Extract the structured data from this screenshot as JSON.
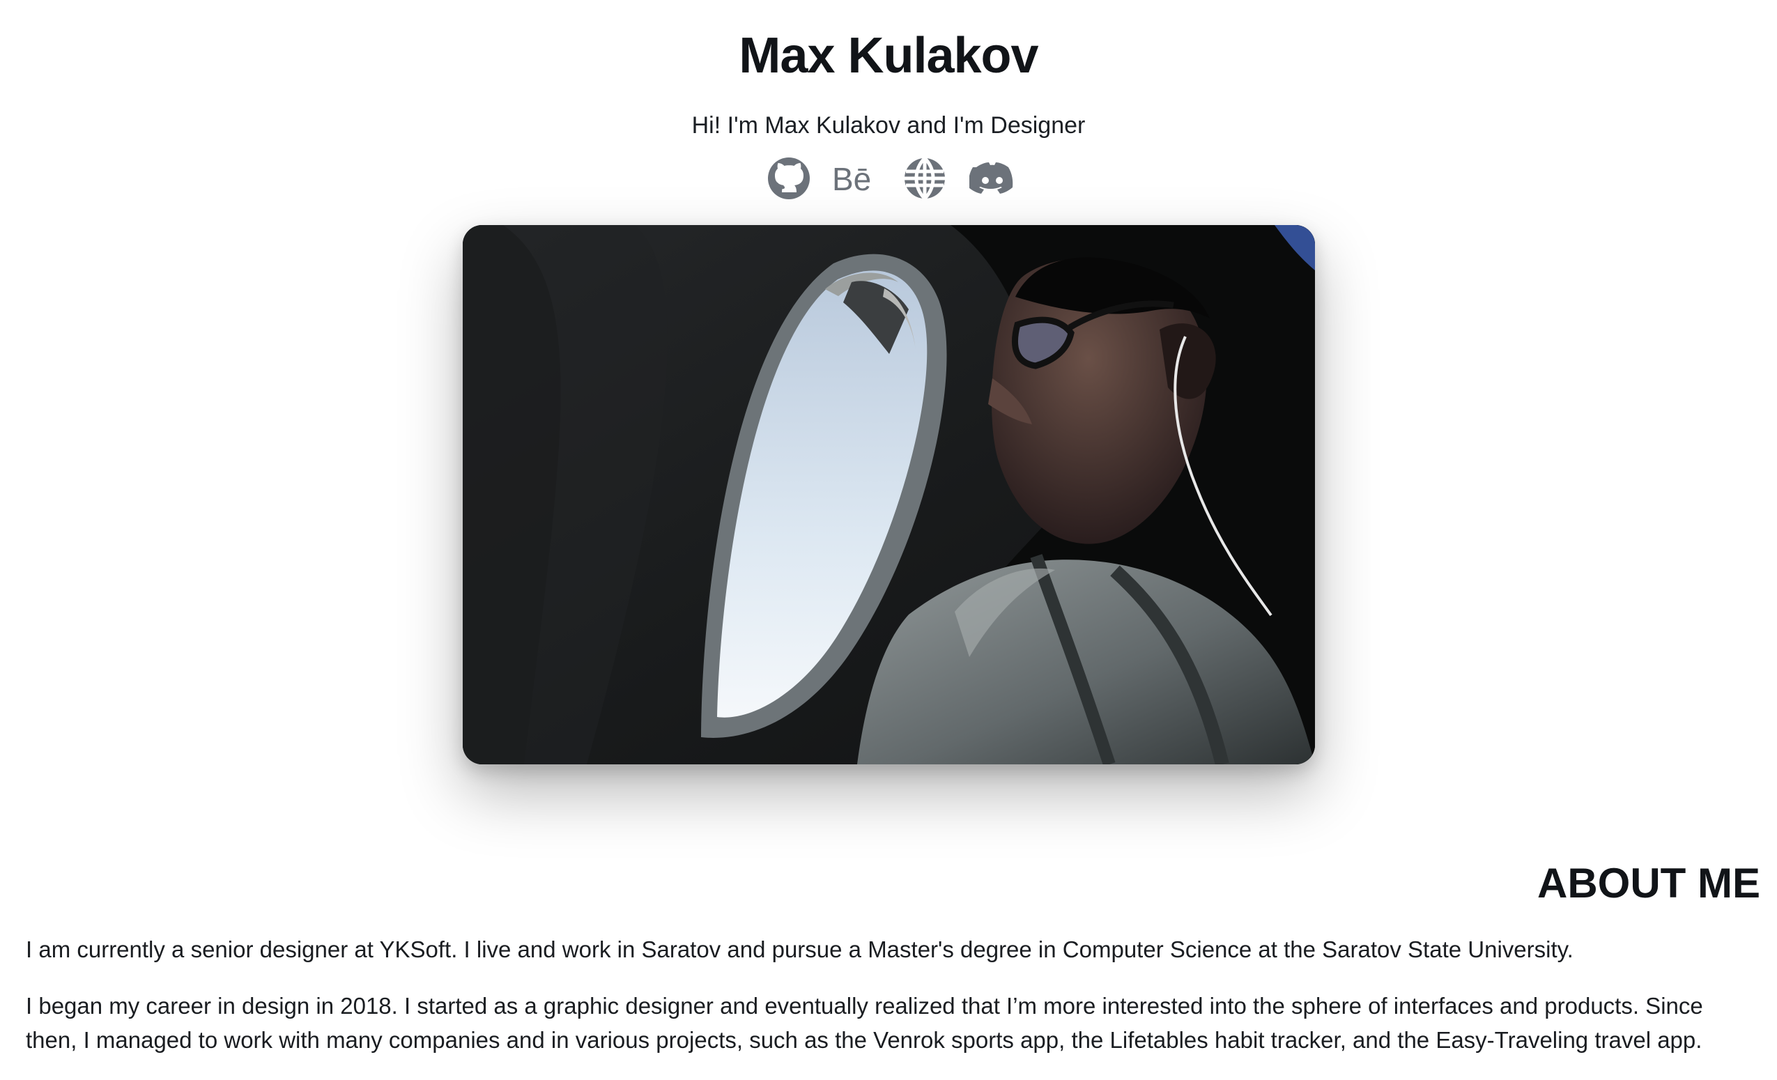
{
  "header": {
    "title": "Max Kulakov",
    "subtitle": "Hi! I'm Max Kulakov and I'm Designer"
  },
  "social_links": [
    {
      "name": "GitHub",
      "icon": "github-icon"
    },
    {
      "name": "Behance",
      "icon": "behance-icon",
      "label": "Bē"
    },
    {
      "name": "Website",
      "icon": "globe-icon"
    },
    {
      "name": "Discord",
      "icon": "discord-icon"
    }
  ],
  "photo": {
    "description_icon": "profile-photo"
  },
  "about": {
    "title": "ABOUT ME",
    "paragraph_1": "I am currently a senior designer at YKSoft. I live and work in Saratov and pursue a Master's degree in Computer Science at the Saratov State University.",
    "paragraph_2": "I began my career in design in 2018. I started as a graphic designer and eventually realized that I’m more interested into the sphere of interfaces and products. Since then, I managed to work with many companies and in various projects, such as the Venrok sports app, the Lifetables habit tracker, and the Easy-Traveling travel app."
  },
  "colors": {
    "text": "#16191d",
    "icon": "#6c727a",
    "background": "#ffffff"
  }
}
